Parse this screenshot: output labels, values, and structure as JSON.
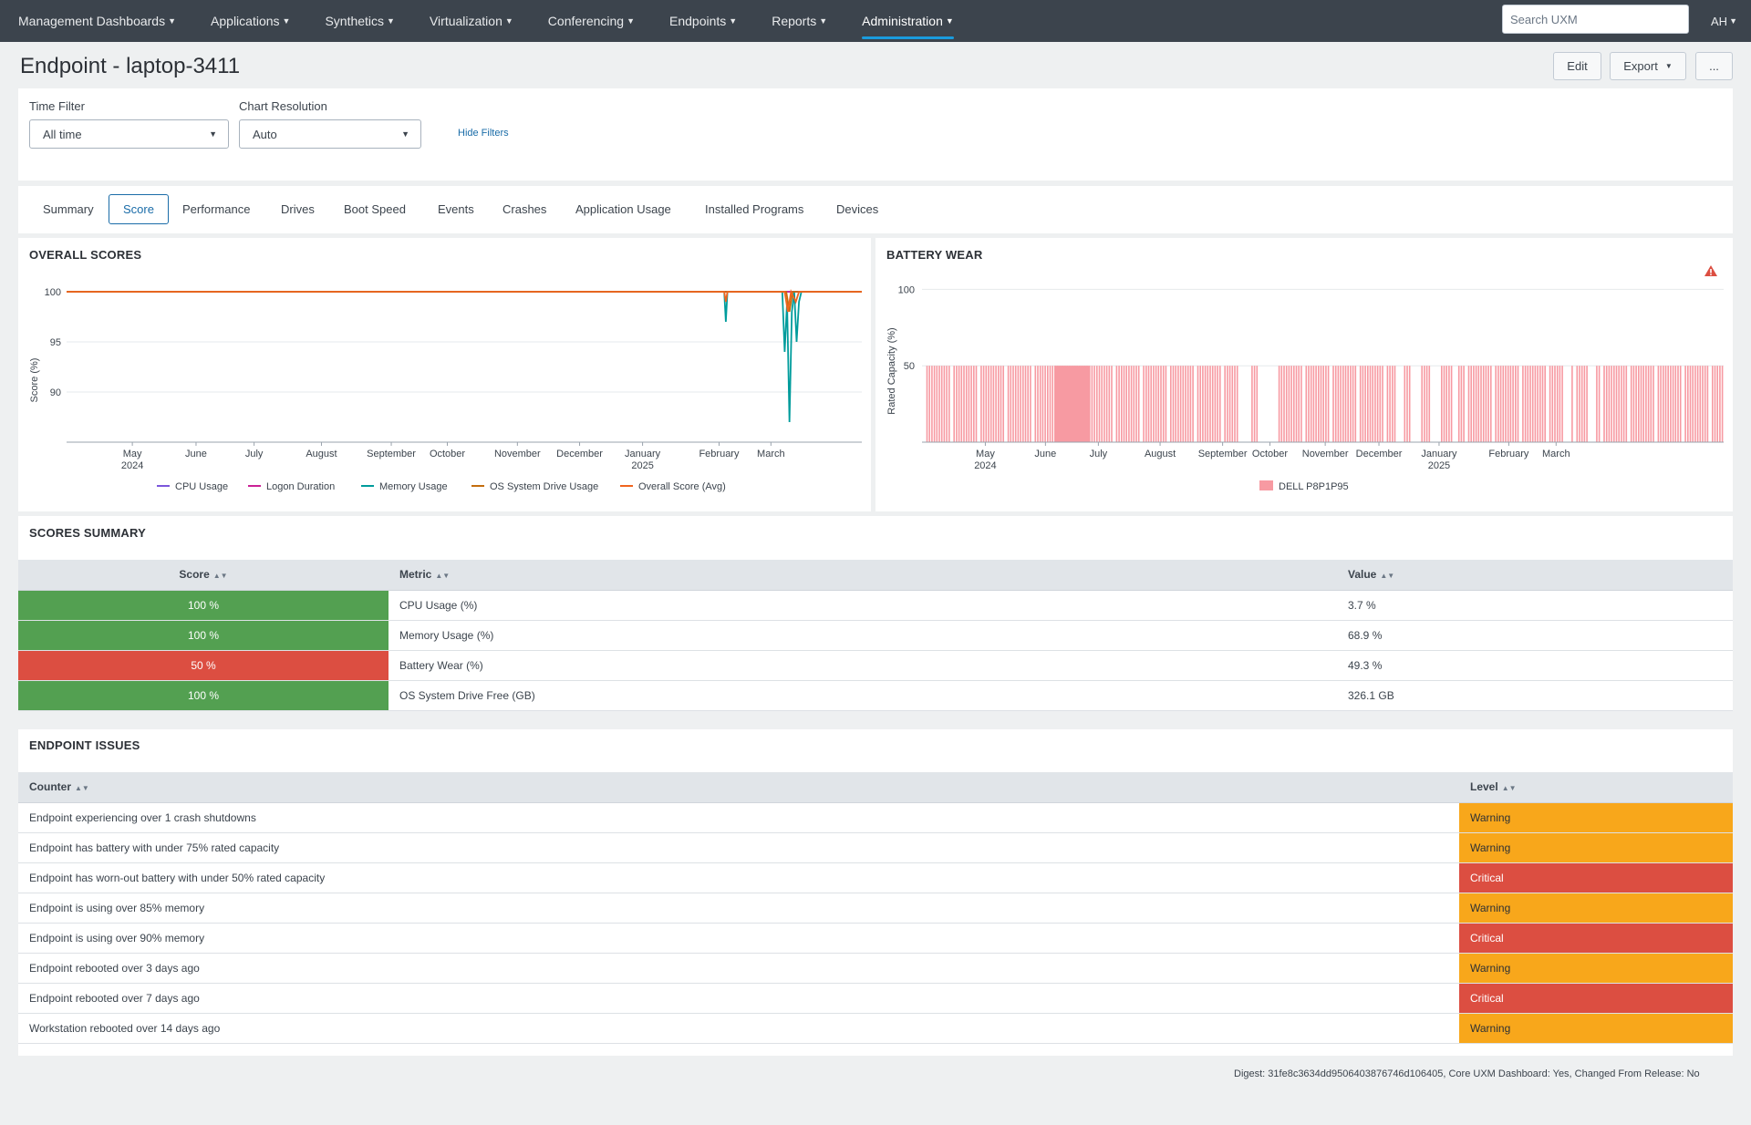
{
  "nav": {
    "items": [
      {
        "label": "Management Dashboards"
      },
      {
        "label": "Applications"
      },
      {
        "label": "Synthetics"
      },
      {
        "label": "Virtualization"
      },
      {
        "label": "Conferencing"
      },
      {
        "label": "Endpoints"
      },
      {
        "label": "Reports"
      },
      {
        "label": "Administration",
        "active": true
      }
    ],
    "search_placeholder": "Search UXM",
    "user_initials": "AH"
  },
  "header": {
    "title": "Endpoint - laptop-3411",
    "edit_label": "Edit",
    "export_label": "Export",
    "more_label": "..."
  },
  "filters": {
    "time_filter_label": "Time Filter",
    "time_filter_value": "All time",
    "chart_resolution_label": "Chart Resolution",
    "chart_resolution_value": "Auto",
    "hide_filters_label": "Hide Filters"
  },
  "tabs": [
    {
      "label": "Summary"
    },
    {
      "label": "Score",
      "active": true
    },
    {
      "label": "Performance"
    },
    {
      "label": "Drives"
    },
    {
      "label": "Boot Speed"
    },
    {
      "label": "Events"
    },
    {
      "label": "Crashes"
    },
    {
      "label": "Application Usage"
    },
    {
      "label": "Installed Programs"
    },
    {
      "label": "Devices"
    }
  ],
  "overall_scores": {
    "title": "OVERALL SCORES",
    "warning_icon": null
  },
  "battery_wear": {
    "title": "BATTERY WEAR",
    "alert_icon": "warning-triangle-icon"
  },
  "chart_data": [
    {
      "type": "line",
      "title": "OVERALL SCORES",
      "ylabel": "Score (%)",
      "xlabel": "",
      "ylim": [
        85,
        101
      ],
      "y_ticks": [
        100,
        95,
        90
      ],
      "x_ticks": [
        "May 2024",
        "June",
        "July",
        "August",
        "September",
        "October",
        "November",
        "December",
        "January 2025",
        "February",
        "March"
      ],
      "series": [
        {
          "name": "CPU Usage",
          "color": "#7b56db",
          "values": [
            [
              0,
              100
            ],
            [
              1,
              100
            ]
          ]
        },
        {
          "name": "Logon Duration",
          "color": "#cb2196",
          "values": [
            [
              0,
              100
            ],
            [
              1,
              100
            ]
          ]
        },
        {
          "name": "Memory Usage",
          "color": "#009c9c",
          "values": [
            [
              0,
              100
            ],
            [
              0.827,
              100
            ],
            [
              0.829,
              97
            ],
            [
              0.831,
              100
            ],
            [
              0.9,
              100
            ],
            [
              0.903,
              94
            ],
            [
              0.906,
              99
            ],
            [
              0.909,
              87
            ],
            [
              0.912,
              98
            ],
            [
              0.915,
              100
            ],
            [
              0.918,
              95
            ],
            [
              0.921,
              99
            ],
            [
              0.924,
              100
            ],
            [
              1,
              100
            ]
          ]
        },
        {
          "name": "OS System Drive Usage",
          "color": "#c46d0e",
          "values": [
            [
              0,
              100
            ],
            [
              0.905,
              100
            ],
            [
              0.909,
              98
            ],
            [
              0.913,
              100
            ],
            [
              1,
              100
            ]
          ]
        },
        {
          "name": "Overall Score (Avg)",
          "color": "#f0641e",
          "values": [
            [
              0,
              100
            ],
            [
              0.827,
              100
            ],
            [
              0.829,
              99
            ],
            [
              0.831,
              100
            ],
            [
              0.903,
              100
            ],
            [
              0.907,
              98
            ],
            [
              0.911,
              100
            ],
            [
              0.917,
              99
            ],
            [
              0.921,
              100
            ],
            [
              1,
              100
            ]
          ]
        }
      ],
      "grid": true,
      "legend": "bottom"
    },
    {
      "type": "bar",
      "title": "BATTERY WEAR",
      "ylabel": "Rated Capacity (%)",
      "ylim": [
        0,
        105
      ],
      "y_ticks": [
        100,
        50
      ],
      "x_ticks": [
        "May 2024",
        "June",
        "July",
        "August",
        "September",
        "October",
        "November",
        "December",
        "January 2025",
        "February",
        "March"
      ],
      "series": [
        {
          "name": "DELL P8P1P95",
          "color": "#f79aa2",
          "value": 50
        }
      ],
      "grid": true,
      "legend": "bottom"
    }
  ],
  "scores_summary": {
    "title": "SCORES SUMMARY",
    "columns": [
      "Score",
      "Metric",
      "Value"
    ],
    "rows": [
      {
        "score": "100 %",
        "status": "green",
        "metric": "CPU Usage (%)",
        "value": "3.7 %"
      },
      {
        "score": "100 %",
        "status": "green",
        "metric": "Memory Usage (%)",
        "value": "68.9 %"
      },
      {
        "score": "50 %",
        "status": "red",
        "metric": "Battery Wear (%)",
        "value": "49.3 %"
      },
      {
        "score": "100 %",
        "status": "green",
        "metric": "OS System Drive Free (GB)",
        "value": "326.1 GB"
      }
    ]
  },
  "endpoint_issues": {
    "title": "ENDPOINT ISSUES",
    "columns": [
      "Counter",
      "Level"
    ],
    "rows": [
      {
        "counter": "Endpoint experiencing over 1 crash shutdowns",
        "level": "Warning"
      },
      {
        "counter": "Endpoint has battery with under 75% rated capacity",
        "level": "Warning"
      },
      {
        "counter": "Endpoint has worn-out battery with under 50% rated capacity",
        "level": "Critical"
      },
      {
        "counter": "Endpoint is using over 85% memory",
        "level": "Warning"
      },
      {
        "counter": "Endpoint is using over 90% memory",
        "level": "Critical"
      },
      {
        "counter": "Endpoint rebooted over 3 days ago",
        "level": "Warning"
      },
      {
        "counter": "Endpoint rebooted over 7 days ago",
        "level": "Critical"
      },
      {
        "counter": "Workstation rebooted over 14 days ago",
        "level": "Warning"
      }
    ]
  },
  "footer": {
    "digest": "Digest: 31fe8c3634dd9506403876746d106405, Core UXM Dashboard: Yes, Changed From Release: No"
  },
  "colors": {
    "nav_bg": "#3c444d",
    "accent": "#1a9cde",
    "ok": "#53a051",
    "critical": "#dc4e41",
    "warning": "#f8a71b",
    "battery_bar": "#f79aa2"
  }
}
